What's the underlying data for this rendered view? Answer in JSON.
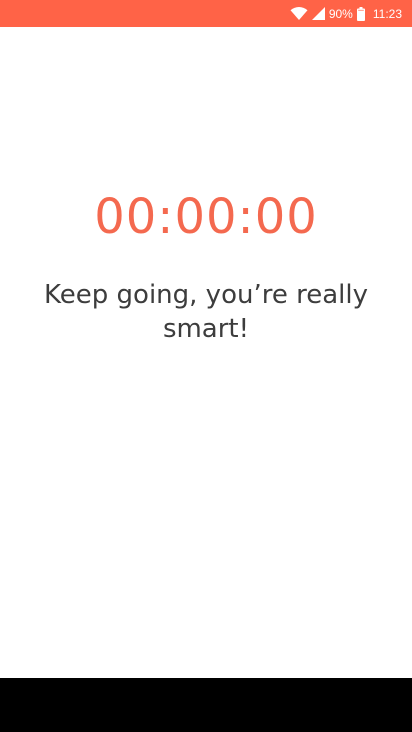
{
  "status_bar": {
    "battery_percent": "90%",
    "time": "11:23",
    "background_color": "#ff6347",
    "icons": [
      "wifi-icon",
      "cell-signal-icon",
      "battery-icon"
    ]
  },
  "main": {
    "timer": "00:00:00",
    "message": "Keep going, you’re really smart!",
    "accent_color": "#f4694f"
  }
}
